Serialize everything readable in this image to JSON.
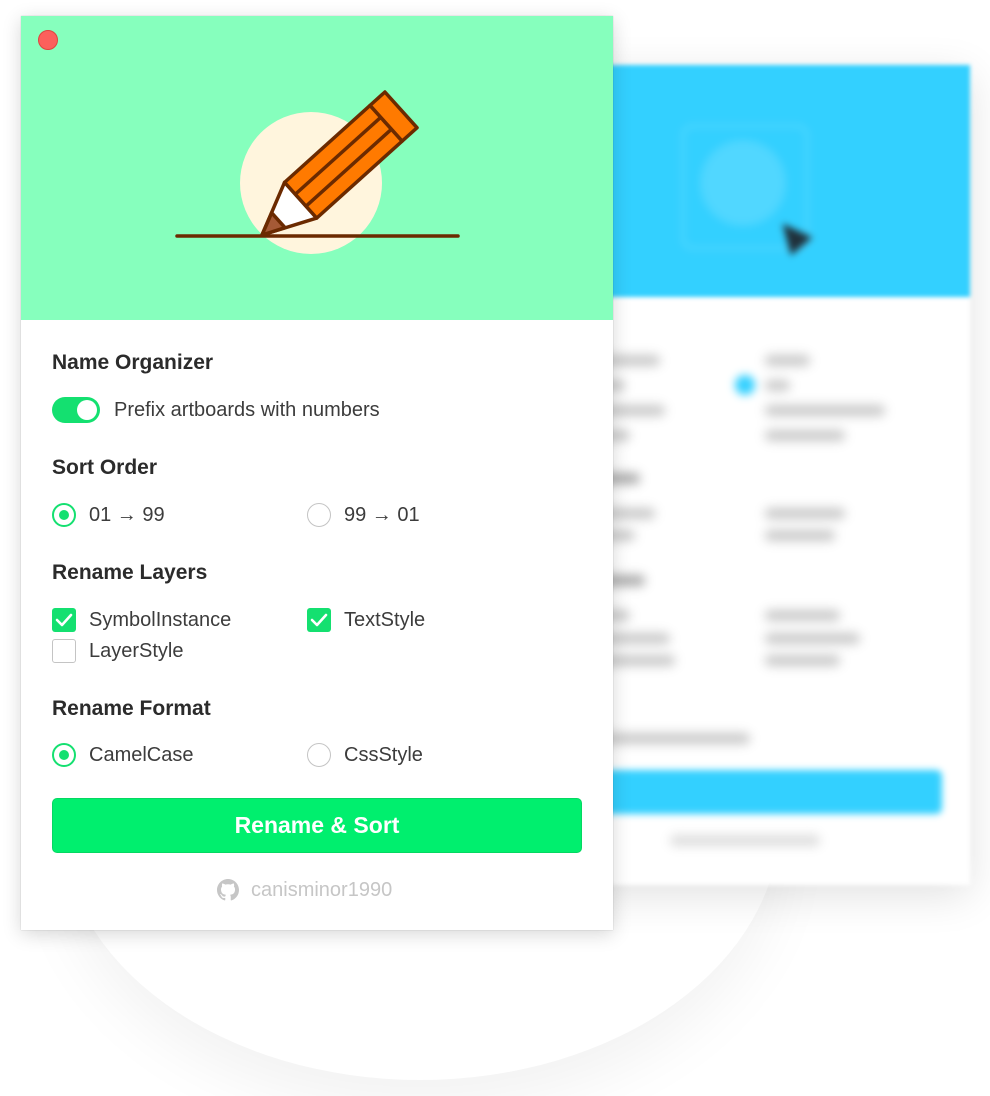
{
  "window": {
    "close_label": ""
  },
  "name_organizer": {
    "title": "Name Organizer",
    "toggle_label": "Prefix artboards with numbers",
    "toggle_on": true
  },
  "sort_order": {
    "title": "Sort Order",
    "options": [
      {
        "label": "01 → 99",
        "selected": true
      },
      {
        "label": "99 → 01",
        "selected": false
      }
    ]
  },
  "rename_layers": {
    "title": "Rename Layers",
    "options": [
      {
        "label": "SymbolInstance",
        "checked": true
      },
      {
        "label": "TextStyle",
        "checked": true
      },
      {
        "label": "LayerStyle",
        "checked": false
      }
    ]
  },
  "rename_format": {
    "title": "Rename Format",
    "options": [
      {
        "label": "CamelCase",
        "selected": true
      },
      {
        "label": "CssStyle",
        "selected": false
      }
    ]
  },
  "action": {
    "label": "Rename & Sort"
  },
  "footer": {
    "username": "canisminor1990",
    "icon": "github-icon"
  },
  "colors": {
    "hero": "#86ffbd",
    "accent": "#14e070",
    "button": "#00ef6e",
    "background_window_accent": "#33d0ff",
    "pencil_orange": "#ff7a00",
    "pencil_outline": "#6b2a00",
    "sun": "#fff5dd"
  }
}
